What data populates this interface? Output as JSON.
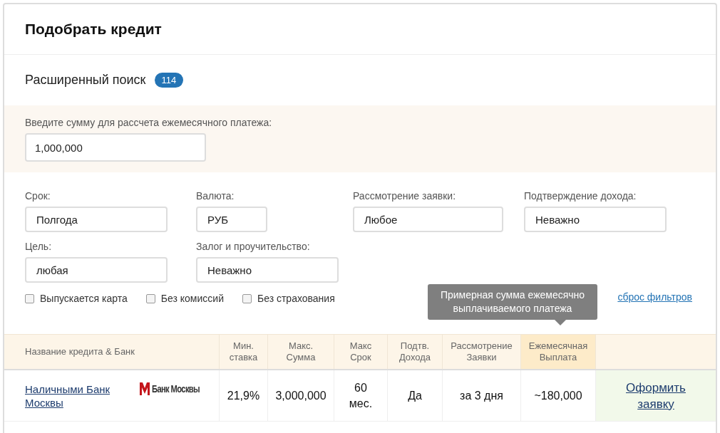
{
  "title": "Подобрать кредит",
  "advanced_search": {
    "label": "Расширенный поиск",
    "count": "114"
  },
  "amount": {
    "label": "Введите сумму для рассчета ежемесячного платежа:",
    "value": "1,000,000"
  },
  "filters": [
    {
      "label": "Срок:",
      "value": "Полгода"
    },
    {
      "label": "Валюта:",
      "value": "РУБ"
    },
    {
      "label": "Рассмотрение заявки:",
      "value": "Любое"
    },
    {
      "label": "Подтверждение дохода:",
      "value": "Неважно"
    },
    {
      "label": "Цель:",
      "value": "любая"
    },
    {
      "label": "Залог и проучительство:",
      "value": "Неважно"
    }
  ],
  "checkboxes": [
    {
      "label": "Выпускается карта",
      "checked": false
    },
    {
      "label": "Без комиссий",
      "checked": false
    },
    {
      "label": "Без страхования",
      "checked": false
    }
  ],
  "reset_link": "сброс фильтров",
  "tooltip": "Примерная сумма ежемесячно выплачиваемого платежа",
  "table": {
    "columns": [
      {
        "label": "Название кредита & Банк",
        "highlighted": false
      },
      {
        "label": "Мин. ставка",
        "highlighted": false
      },
      {
        "label": "Макс. Сумма",
        "highlighted": false
      },
      {
        "label": "Макс Срок",
        "highlighted": false
      },
      {
        "label": "Подтв. Дохода",
        "highlighted": false
      },
      {
        "label": "Рассмотрение Заявки",
        "highlighted": false
      },
      {
        "label": "Ежемесячная Выплата",
        "highlighted": true
      }
    ],
    "rows": [
      {
        "bank_logo": "Банк Москвы",
        "cells": [
          "Наличными Банк Москвы",
          "21,9%",
          "3,000,000",
          "60 мес.",
          "Да",
          "за 3 дня",
          "~180,000"
        ],
        "action": "Оформить заявку"
      }
    ]
  }
}
